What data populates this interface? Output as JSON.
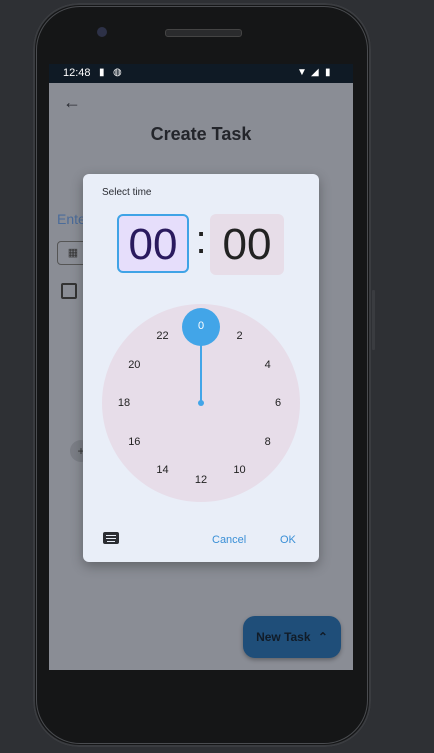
{
  "status_bar": {
    "time": "12:48"
  },
  "page": {
    "title": "Create Task",
    "field_hint": "Ente",
    "add_glyph": "+"
  },
  "fab": {
    "label": "New Task",
    "chevron": "⌃"
  },
  "dialog": {
    "title": "Select time",
    "hour": "00",
    "separator": ":",
    "minute": "00",
    "clock_numbers": [
      "0",
      "2",
      "4",
      "6",
      "8",
      "10",
      "12",
      "14",
      "16",
      "18",
      "20",
      "22"
    ],
    "selected_hour": "0",
    "cancel_label": "Cancel",
    "ok_label": "OK"
  },
  "colors": {
    "accent": "#42a5e8",
    "fab": "#1f4e79"
  }
}
